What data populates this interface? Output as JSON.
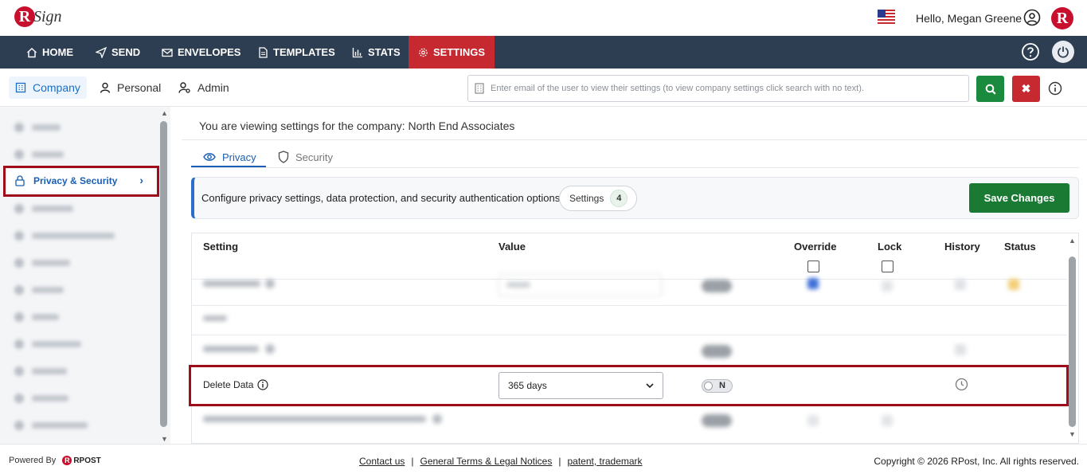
{
  "app": {
    "logo_letter": "R",
    "logo_text": "Sign",
    "greeting": "Hello, Megan Greene",
    "brand_letter": "R"
  },
  "nav": {
    "items": [
      {
        "label": "HOME",
        "icon": "home-icon"
      },
      {
        "label": "SEND",
        "icon": "send-icon"
      },
      {
        "label": "ENVELOPES",
        "icon": "envelope-icon"
      },
      {
        "label": "TEMPLATES",
        "icon": "template-icon"
      },
      {
        "label": "STATS",
        "icon": "stats-icon"
      },
      {
        "label": "SETTINGS",
        "icon": "gear-icon",
        "active": true
      }
    ]
  },
  "subnav": {
    "tabs": [
      {
        "label": "Company",
        "active": true
      },
      {
        "label": "Personal"
      },
      {
        "label": "Admin"
      }
    ],
    "search_placeholder": "Enter email of the user to view their settings (to view company settings click search with no text).",
    "clear_label": "✖"
  },
  "sidebar": {
    "active_item": "Privacy & Security",
    "blurred_item_count": 11
  },
  "main": {
    "viewing_text": "You are viewing settings for the company: North End Associates",
    "tabs": [
      {
        "label": "Privacy",
        "active": true
      },
      {
        "label": "Security"
      }
    ],
    "info_text": "Configure privacy settings, data protection, and security authentication options.",
    "settings_label": "Settings",
    "settings_count": "4",
    "save_label": "Save Changes"
  },
  "table": {
    "headers": {
      "setting": "Setting",
      "value": "Value",
      "override": "Override",
      "lock": "Lock",
      "history": "History",
      "status": "Status"
    },
    "highlighted_row": {
      "setting": "Delete Data",
      "value": "365 days",
      "toggle": "N"
    }
  },
  "footer": {
    "powered_by": "Powered By",
    "rpost": "RPOST",
    "links": [
      "Contact us",
      "General Terms & Legal Notices",
      "patent, trademark"
    ],
    "separator": "|",
    "copyright": "Copyright © 2026 RPost, Inc. All rights reserved."
  },
  "colors": {
    "nav_bg": "#2e3e52",
    "active_red": "#c62930",
    "accent_blue": "#1a5fb4",
    "save_green": "#1a7a34",
    "highlight_border": "#a00d1a"
  }
}
